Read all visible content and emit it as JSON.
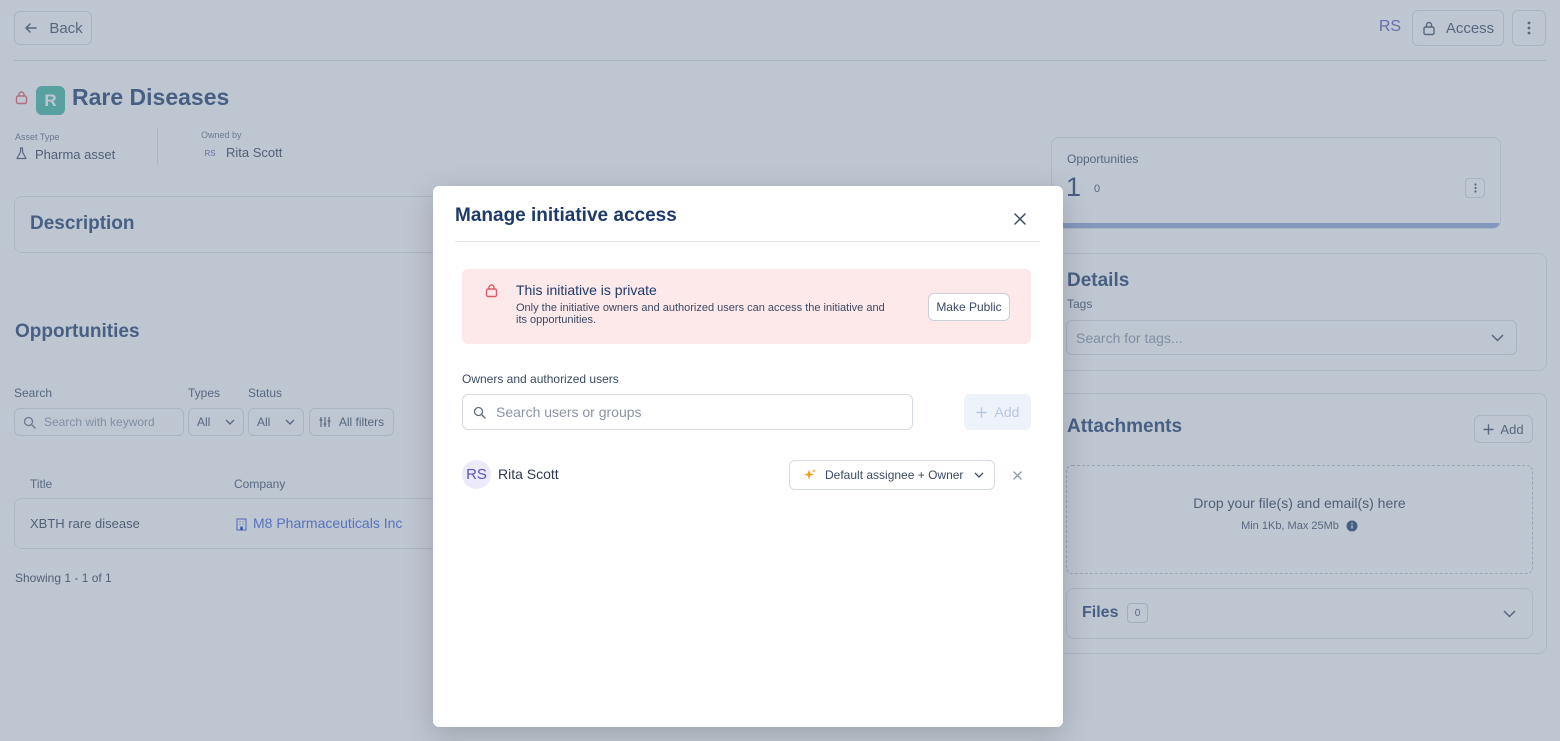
{
  "topbar": {
    "back_label": "Back",
    "user_initials": "RS",
    "access_label": "Access"
  },
  "asset": {
    "badge_letter": "R",
    "title": "Rare Diseases",
    "asset_type_label": "Asset Type",
    "asset_type_value": "Pharma asset",
    "owned_by_label": "Owned by",
    "owner_initials": "RS",
    "owner_name": "Rita Scott"
  },
  "description": {
    "title": "Description"
  },
  "opportunities": {
    "title": "Opportunities",
    "search_label": "Search",
    "search_placeholder": "Search with keyword",
    "types_label": "Types",
    "types_value": "All",
    "status_label": "Status",
    "status_value": "All",
    "all_filters_label": "All filters",
    "columns": [
      "Title",
      "Company"
    ],
    "rows": [
      {
        "title": "XBTH rare disease",
        "company": "M8 Pharmaceuticals Inc"
      }
    ],
    "showing": "Showing 1 - 1 of 1"
  },
  "opportunities_stat": {
    "label": "Opportunities",
    "count": "1",
    "sub_count": "0"
  },
  "details": {
    "title": "Details",
    "tags_label": "Tags",
    "tags_placeholder": "Search for tags..."
  },
  "attachments": {
    "title": "Attachments",
    "add_label": "Add",
    "drop_text": "Drop your file(s) and email(s) here",
    "limits_text": "Min 1Kb, Max 25Mb",
    "files_label": "Files",
    "files_count": "0"
  },
  "modal": {
    "title": "Manage initiative access",
    "alert_title": "This initiative is private",
    "alert_body": "Only the initiative owners and authorized users can access the initiative and its opportunities.",
    "make_public_label": "Make Public",
    "users_section_label": "Owners and authorized users",
    "search_placeholder": "Search users or groups",
    "add_label": "Add",
    "users": [
      {
        "initials": "RS",
        "name": "Rita Scott",
        "role": "Default assignee + Owner"
      }
    ]
  },
  "colors": {
    "navy": "#1e3a6b",
    "alert_bg": "#fde8ea",
    "alert_icon": "#e05a66",
    "role_icon": "#f0a020",
    "link": "#3b5bdb",
    "overlay": "rgba(120,136,158,0.48)"
  }
}
